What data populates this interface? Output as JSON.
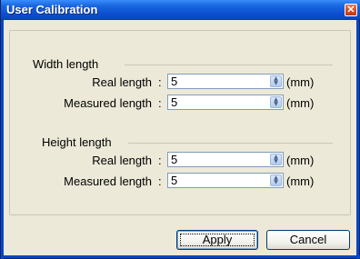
{
  "window": {
    "title": "User Calibration",
    "close_glyph": "✕"
  },
  "width_group": {
    "title": "Width length",
    "real_label": "Real length",
    "real_value": "5",
    "measured_label": "Measured length",
    "measured_value": "5",
    "unit": "(mm)"
  },
  "height_group": {
    "title": "Height length",
    "real_label": "Real length",
    "real_value": "5",
    "measured_label": "Measured length",
    "measured_value": "5",
    "unit": "(mm)"
  },
  "colon": ":",
  "buttons": {
    "apply": "Apply",
    "cancel": "Cancel"
  },
  "colors": {
    "titlebar": "#0a45c0",
    "dialog_bg": "#ece9d8",
    "close": "#d4471f"
  },
  "icons": {
    "spin_arrows": "spinner-up-down-icon",
    "close": "close-icon"
  }
}
